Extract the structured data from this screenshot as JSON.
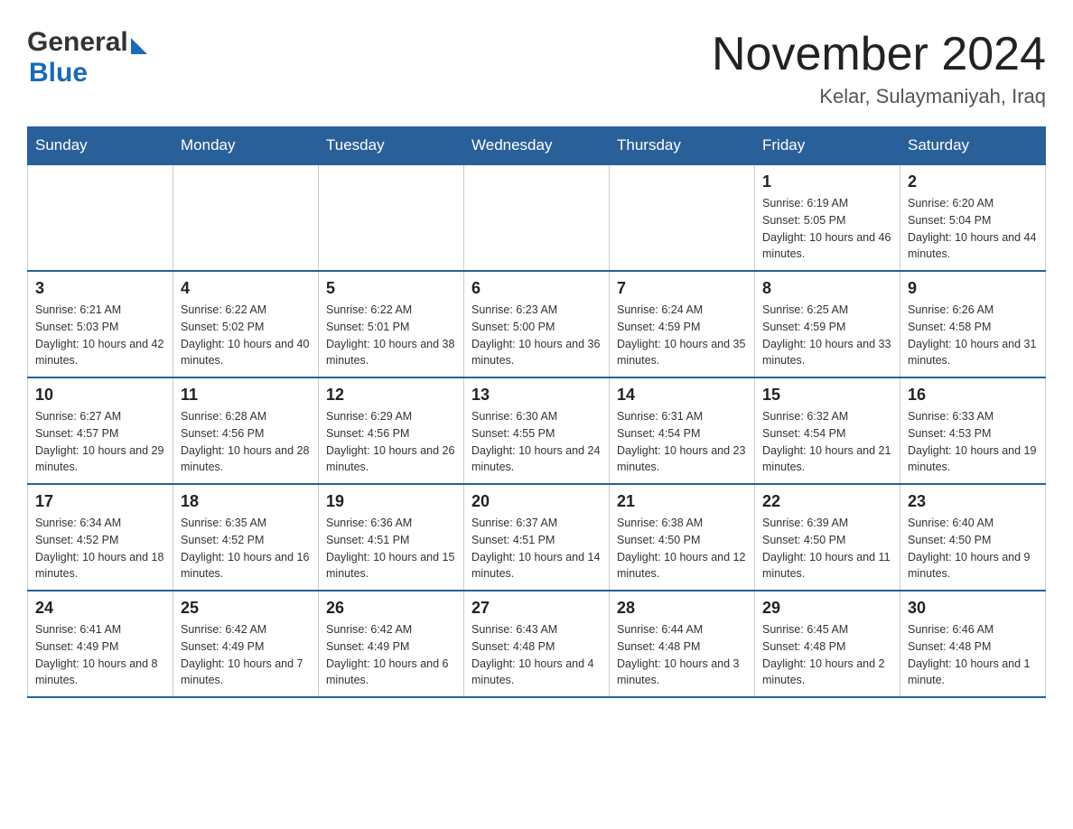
{
  "header": {
    "logo_general": "General",
    "logo_blue": "Blue",
    "month_title": "November 2024",
    "location": "Kelar, Sulaymaniyah, Iraq"
  },
  "weekdays": [
    "Sunday",
    "Monday",
    "Tuesday",
    "Wednesday",
    "Thursday",
    "Friday",
    "Saturday"
  ],
  "weeks": [
    [
      {
        "day": "",
        "info": ""
      },
      {
        "day": "",
        "info": ""
      },
      {
        "day": "",
        "info": ""
      },
      {
        "day": "",
        "info": ""
      },
      {
        "day": "",
        "info": ""
      },
      {
        "day": "1",
        "info": "Sunrise: 6:19 AM\nSunset: 5:05 PM\nDaylight: 10 hours and 46 minutes."
      },
      {
        "day": "2",
        "info": "Sunrise: 6:20 AM\nSunset: 5:04 PM\nDaylight: 10 hours and 44 minutes."
      }
    ],
    [
      {
        "day": "3",
        "info": "Sunrise: 6:21 AM\nSunset: 5:03 PM\nDaylight: 10 hours and 42 minutes."
      },
      {
        "day": "4",
        "info": "Sunrise: 6:22 AM\nSunset: 5:02 PM\nDaylight: 10 hours and 40 minutes."
      },
      {
        "day": "5",
        "info": "Sunrise: 6:22 AM\nSunset: 5:01 PM\nDaylight: 10 hours and 38 minutes."
      },
      {
        "day": "6",
        "info": "Sunrise: 6:23 AM\nSunset: 5:00 PM\nDaylight: 10 hours and 36 minutes."
      },
      {
        "day": "7",
        "info": "Sunrise: 6:24 AM\nSunset: 4:59 PM\nDaylight: 10 hours and 35 minutes."
      },
      {
        "day": "8",
        "info": "Sunrise: 6:25 AM\nSunset: 4:59 PM\nDaylight: 10 hours and 33 minutes."
      },
      {
        "day": "9",
        "info": "Sunrise: 6:26 AM\nSunset: 4:58 PM\nDaylight: 10 hours and 31 minutes."
      }
    ],
    [
      {
        "day": "10",
        "info": "Sunrise: 6:27 AM\nSunset: 4:57 PM\nDaylight: 10 hours and 29 minutes."
      },
      {
        "day": "11",
        "info": "Sunrise: 6:28 AM\nSunset: 4:56 PM\nDaylight: 10 hours and 28 minutes."
      },
      {
        "day": "12",
        "info": "Sunrise: 6:29 AM\nSunset: 4:56 PM\nDaylight: 10 hours and 26 minutes."
      },
      {
        "day": "13",
        "info": "Sunrise: 6:30 AM\nSunset: 4:55 PM\nDaylight: 10 hours and 24 minutes."
      },
      {
        "day": "14",
        "info": "Sunrise: 6:31 AM\nSunset: 4:54 PM\nDaylight: 10 hours and 23 minutes."
      },
      {
        "day": "15",
        "info": "Sunrise: 6:32 AM\nSunset: 4:54 PM\nDaylight: 10 hours and 21 minutes."
      },
      {
        "day": "16",
        "info": "Sunrise: 6:33 AM\nSunset: 4:53 PM\nDaylight: 10 hours and 19 minutes."
      }
    ],
    [
      {
        "day": "17",
        "info": "Sunrise: 6:34 AM\nSunset: 4:52 PM\nDaylight: 10 hours and 18 minutes."
      },
      {
        "day": "18",
        "info": "Sunrise: 6:35 AM\nSunset: 4:52 PM\nDaylight: 10 hours and 16 minutes."
      },
      {
        "day": "19",
        "info": "Sunrise: 6:36 AM\nSunset: 4:51 PM\nDaylight: 10 hours and 15 minutes."
      },
      {
        "day": "20",
        "info": "Sunrise: 6:37 AM\nSunset: 4:51 PM\nDaylight: 10 hours and 14 minutes."
      },
      {
        "day": "21",
        "info": "Sunrise: 6:38 AM\nSunset: 4:50 PM\nDaylight: 10 hours and 12 minutes."
      },
      {
        "day": "22",
        "info": "Sunrise: 6:39 AM\nSunset: 4:50 PM\nDaylight: 10 hours and 11 minutes."
      },
      {
        "day": "23",
        "info": "Sunrise: 6:40 AM\nSunset: 4:50 PM\nDaylight: 10 hours and 9 minutes."
      }
    ],
    [
      {
        "day": "24",
        "info": "Sunrise: 6:41 AM\nSunset: 4:49 PM\nDaylight: 10 hours and 8 minutes."
      },
      {
        "day": "25",
        "info": "Sunrise: 6:42 AM\nSunset: 4:49 PM\nDaylight: 10 hours and 7 minutes."
      },
      {
        "day": "26",
        "info": "Sunrise: 6:42 AM\nSunset: 4:49 PM\nDaylight: 10 hours and 6 minutes."
      },
      {
        "day": "27",
        "info": "Sunrise: 6:43 AM\nSunset: 4:48 PM\nDaylight: 10 hours and 4 minutes."
      },
      {
        "day": "28",
        "info": "Sunrise: 6:44 AM\nSunset: 4:48 PM\nDaylight: 10 hours and 3 minutes."
      },
      {
        "day": "29",
        "info": "Sunrise: 6:45 AM\nSunset: 4:48 PM\nDaylight: 10 hours and 2 minutes."
      },
      {
        "day": "30",
        "info": "Sunrise: 6:46 AM\nSunset: 4:48 PM\nDaylight: 10 hours and 1 minute."
      }
    ]
  ]
}
